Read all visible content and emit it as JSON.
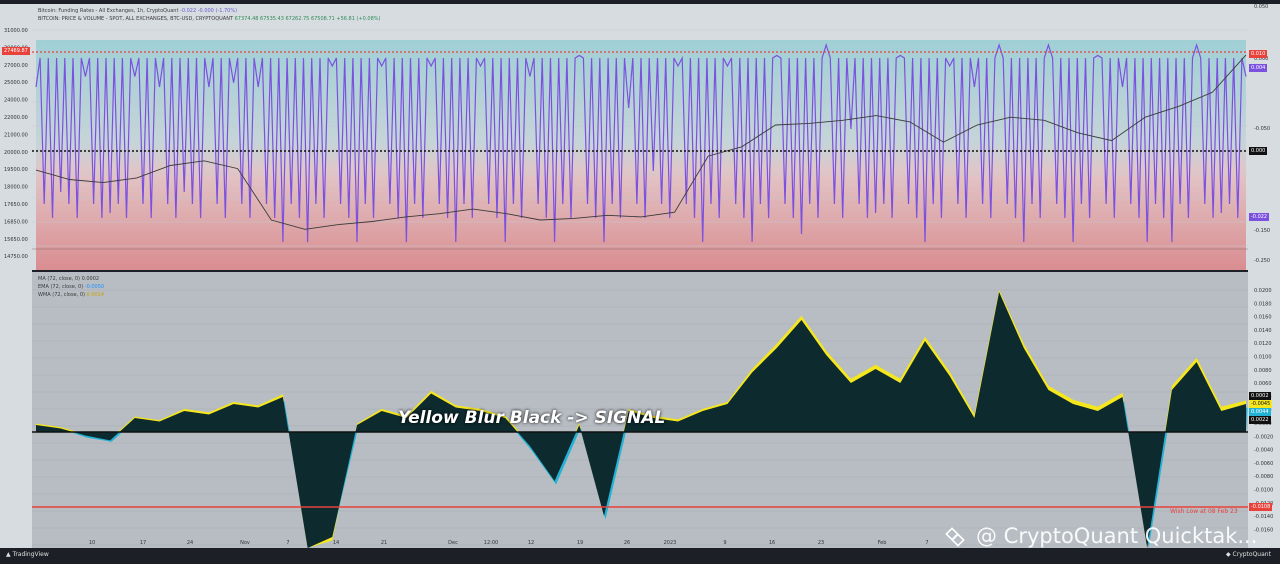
{
  "legend_top": {
    "line1": "Bitcoin: Funding Rates - All Exchanges, 1h, CryptoQuant",
    "line1_vals": "-0.022  -0.000 (-1.70%)",
    "line2": "BITCOIN: PRICE & VOLUME - SPOT, ALL EXCHANGES, BTC-USD, CRYPTOQUANT",
    "line2_vals": "67374.48  67535.43  67262.75  67508.71  +56.81 (+0.08%)"
  },
  "legend_bottom": {
    "ma": "MA (72, close, 0)",
    "ma_val": "0.0002",
    "ema": "EMA (72, close, 0)",
    "ema_val": "-0.0050",
    "wma": "WMA (72, close, 0)",
    "wma_val": "0.0014"
  },
  "annotation": "Yellow Blur Black -> SIGNAL",
  "low_label": "Wish Low at 08 Feb 23",
  "watermark": "@ CryptoQuant Quicktak...",
  "footer_left": "TradingView",
  "footer_right": "CryptoQuant",
  "tags": {
    "left_price": "27469.87",
    "right_red": "0.010",
    "right_purple": "0.004",
    "right_black": "0.000",
    "right_purple2": "-0.022",
    "right_bottom_red": "-0.0108",
    "right_b1": "0.0002",
    "right_b2": "-0.0045",
    "right_b3": "0.0044",
    "right_b4": "0.0022"
  },
  "colors": {
    "funding": "#7b52e0",
    "price": "#3b3b3b",
    "red_line": "#e8423a",
    "area": "#0d2a2e",
    "ema": "#22b2d6",
    "wma": "#f5e61e"
  },
  "chart_data": [
    {
      "type": "line",
      "title": "Bitcoin: Funding Rates - All Exchanges, 1h, CryptoQuant",
      "x": [
        "10",
        "17",
        "24",
        "Nov",
        "7",
        "14",
        "21",
        "Dec",
        "12:00",
        "12",
        "19",
        "26",
        "2023",
        "9",
        "16",
        "23",
        "Feb",
        "7"
      ],
      "y_left_ticks": [
        "31000.00",
        "29000.00",
        "27000.00",
        "25000.00",
        "24000.00",
        "22000.00",
        "21000.00",
        "20000.00",
        "19500.00",
        "18000.00",
        "17650.00",
        "16850.00",
        "15650.00",
        "14750.00"
      ],
      "y_right_ticks": [
        "0.050",
        "0.000",
        "-0.050",
        "-0.150",
        "-0.250"
      ],
      "series": [
        {
          "name": "Funding Rates",
          "values": [
            0.03,
            -0.02,
            0.035,
            -0.03,
            0.035,
            0.03,
            -0.02,
            0.03,
            0.032,
            0.03,
            -0.14,
            -0.06,
            0.04,
            -0.07,
            0.04,
            -0.09,
            0.04,
            -0.05,
            0.04,
            -0.08,
            0.035,
            -0.06,
            0.045,
            -0.09,
            0.02,
            -0.01,
            0.04,
            -0.07,
            0.04,
            -0.06,
            0.045,
            -0.04,
            0.05,
            0.01,
            -0.03,
            0.045,
            -0.05,
            0.04,
            0.03,
            0.05,
            -0.05,
            0.05,
            -0.08,
            0.045,
            0.03,
            -0.15,
            -0.05,
            0.05,
            -0.03,
            0.035
          ]
        },
        {
          "name": "Price",
          "values": [
            20000,
            19400,
            19200,
            19500,
            20300,
            20600,
            20100,
            16800,
            16200,
            16500,
            16700,
            17000,
            17200,
            17500,
            17200,
            16800,
            16900,
            17100,
            17000,
            17300,
            20900,
            21500,
            22900,
            23000,
            23200,
            23500,
            23100,
            21800,
            22900,
            23400,
            23200,
            22400,
            21900,
            23400,
            24100,
            25000,
            27400
          ]
        }
      ]
    },
    {
      "type": "area",
      "title": "MA / EMA / WMA",
      "x": [
        "10",
        "17",
        "24",
        "Nov",
        "7",
        "14",
        "21",
        "Dec",
        "12:00",
        "12",
        "19",
        "26",
        "2023",
        "9",
        "16",
        "23",
        "Feb",
        "7"
      ],
      "y_ticks": [
        "0.0200",
        "0.0180",
        "0.0160",
        "0.0140",
        "0.0120",
        "0.0100",
        "0.0080",
        "0.0060",
        "0.0040",
        "0.0020",
        "0.0000",
        "-0.0020",
        "-0.0040",
        "-0.0060",
        "-0.0080",
        "-0.0100",
        "-0.0120",
        "-0.0140",
        "-0.0160"
      ],
      "series": [
        {
          "name": "MA (72, close, 0)",
          "values": [
            0.001,
            0.0005,
            -0.0005,
            -0.0012,
            0.002,
            0.0015,
            0.003,
            0.0025,
            0.004,
            0.0035,
            0.005,
            -0.018,
            -0.015,
            0.001,
            0.003,
            0.002,
            0.0055,
            0.0035,
            0.003,
            0.002,
            -0.002,
            -0.007,
            0.001,
            -0.012,
            0.003,
            0.002,
            0.0015,
            0.003,
            0.004,
            0.0085,
            0.012,
            0.016,
            0.011,
            0.007,
            0.009,
            0.007,
            0.013,
            0.008,
            0.002,
            0.02,
            0.012,
            0.006,
            0.004,
            0.003,
            0.005,
            -0.018,
            0.006,
            0.01,
            0.003,
            0.004
          ]
        },
        {
          "name": "EMA (72, close, 0)",
          "values": [
            0.0008,
            0.0004,
            -0.0008,
            -0.0014,
            0.0018,
            0.0013,
            0.0027,
            0.0022,
            0.0036,
            0.0031,
            0.0044,
            -0.017,
            -0.014,
            0.0008,
            0.0026,
            0.0018,
            0.005,
            0.003,
            0.0026,
            0.0016,
            -0.0026,
            -0.0075,
            0.0006,
            -0.0125,
            0.0026,
            0.0016,
            0.0012,
            0.0026,
            0.0036,
            0.008,
            0.0114,
            0.0154,
            0.0104,
            0.0064,
            0.0085,
            0.0065,
            0.0124,
            0.0074,
            0.0015,
            0.0194,
            0.0114,
            0.0054,
            0.0034,
            0.0024,
            0.0044,
            -0.017,
            0.0054,
            0.0094,
            0.0024,
            0.0035
          ]
        },
        {
          "name": "WMA (72, close, 0)",
          "values": [
            0.0012,
            0.0007,
            -0.0003,
            -0.001,
            0.0022,
            0.0017,
            0.0033,
            0.0028,
            0.0043,
            0.0038,
            0.0054,
            -0.018,
            -0.0155,
            0.0012,
            0.0033,
            0.0023,
            0.0059,
            0.0038,
            0.0033,
            0.0023,
            -0.0017,
            -0.0067,
            0.0013,
            -0.0117,
            0.0033,
            0.0023,
            0.0018,
            0.0033,
            0.0043,
            0.009,
            0.0126,
            0.0166,
            0.0116,
            0.0076,
            0.0096,
            0.0076,
            0.0136,
            0.0086,
            0.0025,
            0.0206,
            0.0126,
            0.0066,
            0.0046,
            0.0036,
            0.0056,
            -0.018,
            0.0066,
            0.0106,
            0.0036,
            0.0045
          ]
        }
      ]
    }
  ]
}
